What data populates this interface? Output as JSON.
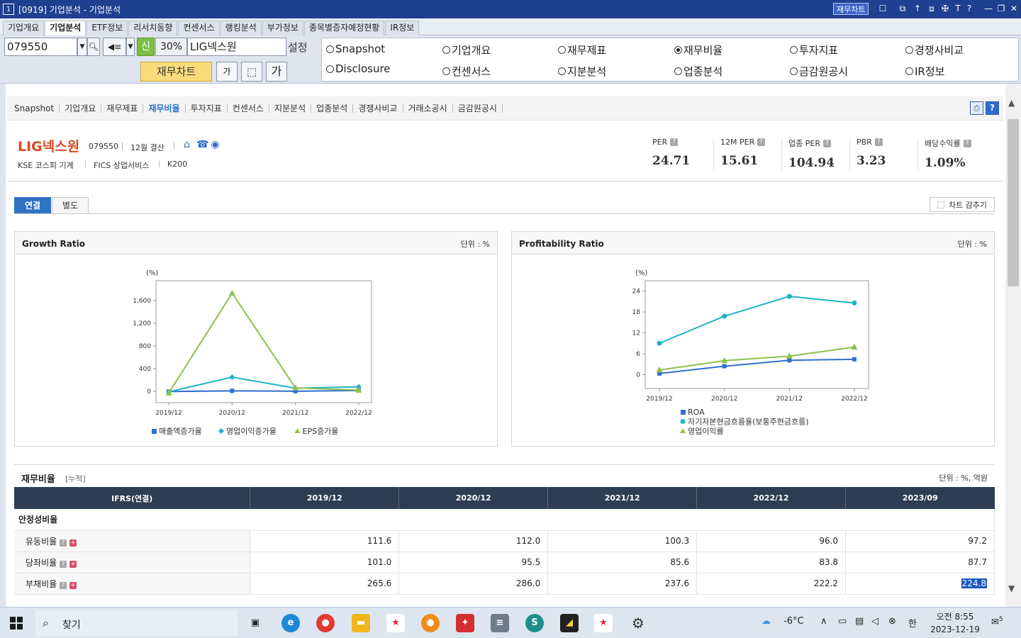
{
  "window": {
    "num": "1",
    "title": "[0919] 기업분석 - 기업분석",
    "fin_chart_btn": "재무차트"
  },
  "top_tabs": [
    "기업개요",
    "기업분석",
    "ETF정보",
    "리서치동향",
    "컨센서스",
    "랭킹분석",
    "부가정보",
    "종목별증자예정현황",
    "IR정보"
  ],
  "search": {
    "code": "079550",
    "sin": "신",
    "pct": "30%",
    "company": "LIG넥스원",
    "setup": "설정",
    "fin_chart": "재무차트",
    "ga_small": "가",
    "ga_large": "가"
  },
  "radios": [
    {
      "label": "Snapshot",
      "checked": false
    },
    {
      "label": "기업개요",
      "checked": false
    },
    {
      "label": "재무제표",
      "checked": false
    },
    {
      "label": "재무비율",
      "checked": true
    },
    {
      "label": "투자지표",
      "checked": false
    },
    {
      "label": "경쟁사비교",
      "checked": false
    },
    {
      "label": "Disclosure",
      "checked": false
    },
    {
      "label": "컨센서스",
      "checked": false
    },
    {
      "label": "지분분석",
      "checked": false
    },
    {
      "label": "업종분석",
      "checked": false
    },
    {
      "label": "금감원공시",
      "checked": false
    },
    {
      "label": "IR정보",
      "checked": false
    }
  ],
  "subnav": [
    "Snapshot",
    "기업개요",
    "재무제표",
    "재무비율",
    "투자지표",
    "컨센서스",
    "지분분석",
    "업종분석",
    "경쟁사비교",
    "거래소공시",
    "금감원공시"
  ],
  "company": {
    "name": "LIG넥스원",
    "code": "079550",
    "settle": "12월 결산",
    "market": "KSE  코스피 기계",
    "fics": "FICS 상업서비스",
    "index": "K200"
  },
  "metrics": [
    {
      "label": "PER",
      "value": "24.71"
    },
    {
      "label": "12M PER",
      "value": "15.61"
    },
    {
      "label": "업종 PER",
      "value": "104.94"
    },
    {
      "label": "PBR",
      "value": "3.23"
    },
    {
      "label": "배당수익률",
      "value": "1.09%"
    }
  ],
  "view_tabs": [
    "연결",
    "별도"
  ],
  "chart_hide": "차트 감추기",
  "panels": {
    "growth_title": "Growth Ratio",
    "profit_title": "Profitability Ratio",
    "unit": "단위 : %"
  },
  "chart_data": [
    {
      "type": "line",
      "title": "Growth Ratio",
      "ylabel": "(%)",
      "categories": [
        "2019/12",
        "2020/12",
        "2021/12",
        "2022/12"
      ],
      "yticks": [
        "0",
        "400",
        "800",
        "1,200",
        "1,600"
      ],
      "ylim": [
        -200,
        1950
      ],
      "grid": false,
      "legend_position": "bottom",
      "series": [
        {
          "name": "매출액증가율",
          "color": "#2f6fd1",
          "marker": "square",
          "values": [
            -4,
            8,
            2,
            14
          ]
        },
        {
          "name": "영업이익증가율",
          "color": "#1fb2c6",
          "marker": "diamond",
          "values": [
            -10,
            250,
            55,
            80
          ]
        },
        {
          "name": "EPS증가율",
          "color": "#8fc14a",
          "marker": "triangle",
          "values": [
            -30,
            1730,
            60,
            20
          ]
        }
      ]
    },
    {
      "type": "line",
      "title": "Profitability Ratio",
      "ylabel": "(%)",
      "categories": [
        "2019/12",
        "2020/12",
        "2021/12",
        "2022/12"
      ],
      "yticks": [
        "0",
        "6",
        "12",
        "18",
        "24"
      ],
      "ylim": [
        -4,
        27
      ],
      "grid": false,
      "legend_position": "bottom",
      "series": [
        {
          "name": "ROA",
          "color": "#2f6fd1",
          "marker": "square",
          "values": [
            0.3,
            2.4,
            4.1,
            4.4
          ]
        },
        {
          "name": "자기자본현금흐름율(보통주현금흐름)",
          "color": "#1fb2c6",
          "marker": "circle",
          "values": [
            9.0,
            16.8,
            22.5,
            20.6
          ]
        },
        {
          "name": "영업이익률",
          "color": "#8fc14a",
          "marker": "triangle",
          "values": [
            1.3,
            4.0,
            5.3,
            7.9
          ]
        }
      ]
    }
  ],
  "table": {
    "title": "재무비율",
    "sub": "[누적]",
    "unit": "단위 : %, 억원",
    "header": [
      "IFRS(연결)",
      "2019/12",
      "2020/12",
      "2021/12",
      "2022/12",
      "2023/09"
    ],
    "group": "안정성비율",
    "rows": [
      {
        "label": "유동비율",
        "values": [
          "111.6",
          "112.0",
          "100.3",
          "96.0",
          "97.2"
        ]
      },
      {
        "label": "당좌비율",
        "values": [
          "101.0",
          "95.5",
          "85.6",
          "83.8",
          "87.7"
        ]
      },
      {
        "label": "부채비율",
        "values": [
          "265.6",
          "286.0",
          "237.6",
          "222.2",
          "224.8"
        ]
      }
    ]
  },
  "taskbar": {
    "search": "찾기",
    "weather": "-6°C",
    "ime": "한",
    "time": "오전 8:55",
    "date": "2023-12-19",
    "notif_count": "5"
  }
}
